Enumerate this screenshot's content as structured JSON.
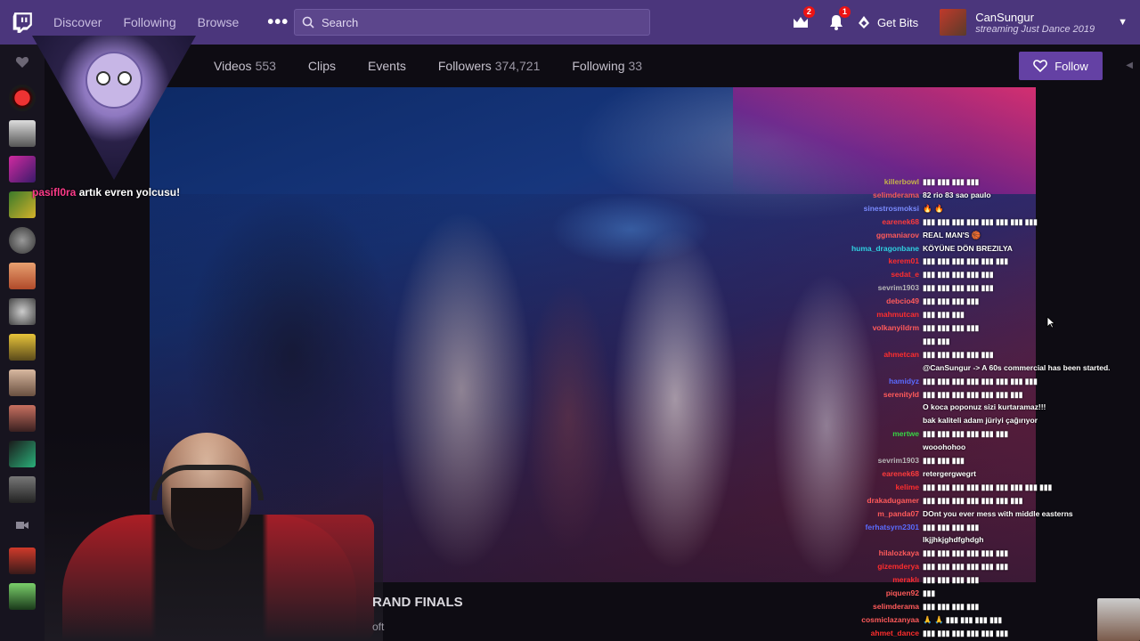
{
  "nav": {
    "discover": "Discover",
    "following": "Following",
    "browse": "Browse",
    "more": "•••",
    "search_placeholder": "Search",
    "prime_badge": "2",
    "notif_badge": "1",
    "get_bits": "Get Bits",
    "user_name": "CanSungur",
    "user_status": "streaming Just Dance 2019"
  },
  "channel": {
    "tabs": [
      {
        "label": "Videos",
        "count": "553"
      },
      {
        "label": "Clips",
        "count": ""
      },
      {
        "label": "Events",
        "count": ""
      },
      {
        "label": "Followers",
        "count": "374,721"
      },
      {
        "label": "Following",
        "count": "33"
      }
    ],
    "follow": "Follow"
  },
  "overlay": {
    "user": "pasifl0ra",
    "text": "artık evren yolcusu!"
  },
  "chat": [
    {
      "u": "killerbowl",
      "c": "#c4b24a",
      "m": "▮▮▮ ▮▮▮ ▮▮▮ ▮▮▮"
    },
    {
      "u": "selimderama",
      "c": "#ff5a5a",
      "m": "82 rio 83 sao paulo"
    },
    {
      "u": "sinestrosmoksi",
      "c": "#7a8bff",
      "m": "🔥 🔥"
    },
    {
      "u": "earenek68",
      "c": "#ff3b3b",
      "m": "▮▮▮ ▮▮▮ ▮▮▮ ▮▮▮ ▮▮▮ ▮▮▮ ▮▮▮ ▮▮▮"
    },
    {
      "u": "ggmaniarov",
      "c": "#ff5a5a",
      "m": "REAL MAN'S 🏀"
    },
    {
      "u": "huma_dragonbane",
      "c": "#2fd0e0",
      "m": "KÖYÜNE DÖN BREZILYA"
    },
    {
      "u": "kerem01",
      "c": "#ff2d2d",
      "m": "▮▮▮ ▮▮▮ ▮▮▮ ▮▮▮ ▮▮▮ ▮▮▮"
    },
    {
      "u": "sedat_e",
      "c": "#ff2d2d",
      "m": "▮▮▮ ▮▮▮ ▮▮▮ ▮▮▮ ▮▮▮"
    },
    {
      "u": "sevrim1903",
      "c": "#b7b7b7",
      "m": "▮▮▮ ▮▮▮ ▮▮▮ ▮▮▮ ▮▮▮"
    },
    {
      "u": "debcio49",
      "c": "#ff5a5a",
      "m": "▮▮▮ ▮▮▮ ▮▮▮ ▮▮▮"
    },
    {
      "u": "mahmutcan",
      "c": "#ff2d2d",
      "m": "▮▮▮ ▮▮▮ ▮▮▮"
    },
    {
      "u": "volkanyildrm",
      "c": "#ff5a5a",
      "m": "▮▮▮ ▮▮▮ ▮▮▮ ▮▮▮"
    },
    {
      "u": "",
      "c": "#ff5a5a",
      "m": "▮▮▮ ▮▮▮"
    },
    {
      "u": "ahmetcan",
      "c": "#ff2d2d",
      "m": "▮▮▮ ▮▮▮ ▮▮▮ ▮▮▮ ▮▮▮"
    },
    {
      "u": "",
      "c": "#ff5a5a",
      "m": "@CanSungur -> A 60s commercial has been started."
    },
    {
      "u": "hamidyz",
      "c": "#5a6bff",
      "m": "▮▮▮ ▮▮▮ ▮▮▮ ▮▮▮ ▮▮▮ ▮▮▮ ▮▮▮ ▮▮▮"
    },
    {
      "u": "serenityld",
      "c": "#ff5a5a",
      "m": "▮▮▮ ▮▮▮ ▮▮▮ ▮▮▮ ▮▮▮ ▮▮▮ ▮▮▮"
    },
    {
      "u": "",
      "c": "#ff5a5a",
      "m": "O koca poponuz sizi kurtaramaz!!!"
    },
    {
      "u": "",
      "c": "#ff5a5a",
      "m": "bak kaliteli adam jüriyi çağırıyor"
    },
    {
      "u": "mertwe",
      "c": "#37d645",
      "m": "▮▮▮ ▮▮▮ ▮▮▮ ▮▮▮ ▮▮▮ ▮▮▮"
    },
    {
      "u": "",
      "c": "#ff5a5a",
      "m": "wooohohoo"
    },
    {
      "u": "sevrim1903",
      "c": "#b7b7b7",
      "m": "▮▮▮ ▮▮▮ ▮▮▮"
    },
    {
      "u": "earenek68",
      "c": "#ff3b3b",
      "m": "retergergwegrt"
    },
    {
      "u": "kelime",
      "c": "#ff2d2d",
      "m": "▮▮▮ ▮▮▮ ▮▮▮ ▮▮▮ ▮▮▮ ▮▮▮ ▮▮▮ ▮▮▮ ▮▮▮"
    },
    {
      "u": "drakadugamer",
      "c": "#ff5a5a",
      "m": "▮▮▮ ▮▮▮ ▮▮▮ ▮▮▮ ▮▮▮ ▮▮▮ ▮▮▮"
    },
    {
      "u": "m_panda07",
      "c": "#ff5a5a",
      "m": "DOnt you ever mess with middle easterns"
    },
    {
      "u": "ferhatsyrn2301",
      "c": "#5a6bff",
      "m": "▮▮▮ ▮▮▮ ▮▮▮ ▮▮▮"
    },
    {
      "u": "",
      "c": "#ff5a5a",
      "m": "lkjjhkjghdfghdgh"
    },
    {
      "u": "hilalozkaya",
      "c": "#ff5a5a",
      "m": "▮▮▮ ▮▮▮ ▮▮▮ ▮▮▮ ▮▮▮ ▮▮▮"
    },
    {
      "u": "gizemderya",
      "c": "#ff2d2d",
      "m": "▮▮▮ ▮▮▮ ▮▮▮ ▮▮▮ ▮▮▮ ▮▮▮"
    },
    {
      "u": "meraklı",
      "c": "#ff2d2d",
      "m": "▮▮▮ ▮▮▮ ▮▮▮ ▮▮▮"
    },
    {
      "u": "piquen92",
      "c": "#ff5a5a",
      "m": "▮▮▮"
    },
    {
      "u": "selimderama",
      "c": "#ff5a5a",
      "m": "▮▮▮ ▮▮▮ ▮▮▮ ▮▮▮"
    },
    {
      "u": "cosmiclazanyaa",
      "c": "#ff5a5a",
      "m": "🙏 🙏 ▮▮▮ ▮▮▮ ▮▮▮ ▮▮▮"
    },
    {
      "u": "ahmet_dance",
      "c": "#ff2d2d",
      "m": "▮▮▮ ▮▮▮ ▮▮▮ ▮▮▮ ▮▮▮ ▮▮▮"
    }
  ],
  "stream": {
    "title_partial": "RAND FINALS",
    "sub_partial": "oft"
  }
}
